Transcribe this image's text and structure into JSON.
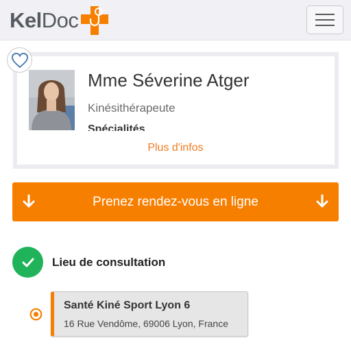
{
  "header": {
    "logo_text_bold": "Kel",
    "logo_text_light": "Doc",
    "menu_icon": "hamburger-icon"
  },
  "practitioner": {
    "favorite_icon": "heart-outline-icon",
    "name": "Mme Séverine Atger",
    "role": "Kinésithérapeute",
    "specialties_label": "Spécialités",
    "more_info_link": "Plus d'infos"
  },
  "booking": {
    "cta_label": "Prenez rendez-vous en ligne",
    "cta_icon": "arrow-down-icon"
  },
  "location_step": {
    "check_icon": "check-icon",
    "title": "Lieu de consultation",
    "options": [
      {
        "name": "Santé Kiné Sport Lyon 6",
        "address": "16 Rue Vendôme, 69006 Lyon, France",
        "selected": true
      }
    ]
  },
  "colors": {
    "brand_orange": "#f77f00",
    "link_orange": "#ee7b21",
    "success_green": "#20b35a",
    "navbar_bg": "#f0f0f5"
  }
}
